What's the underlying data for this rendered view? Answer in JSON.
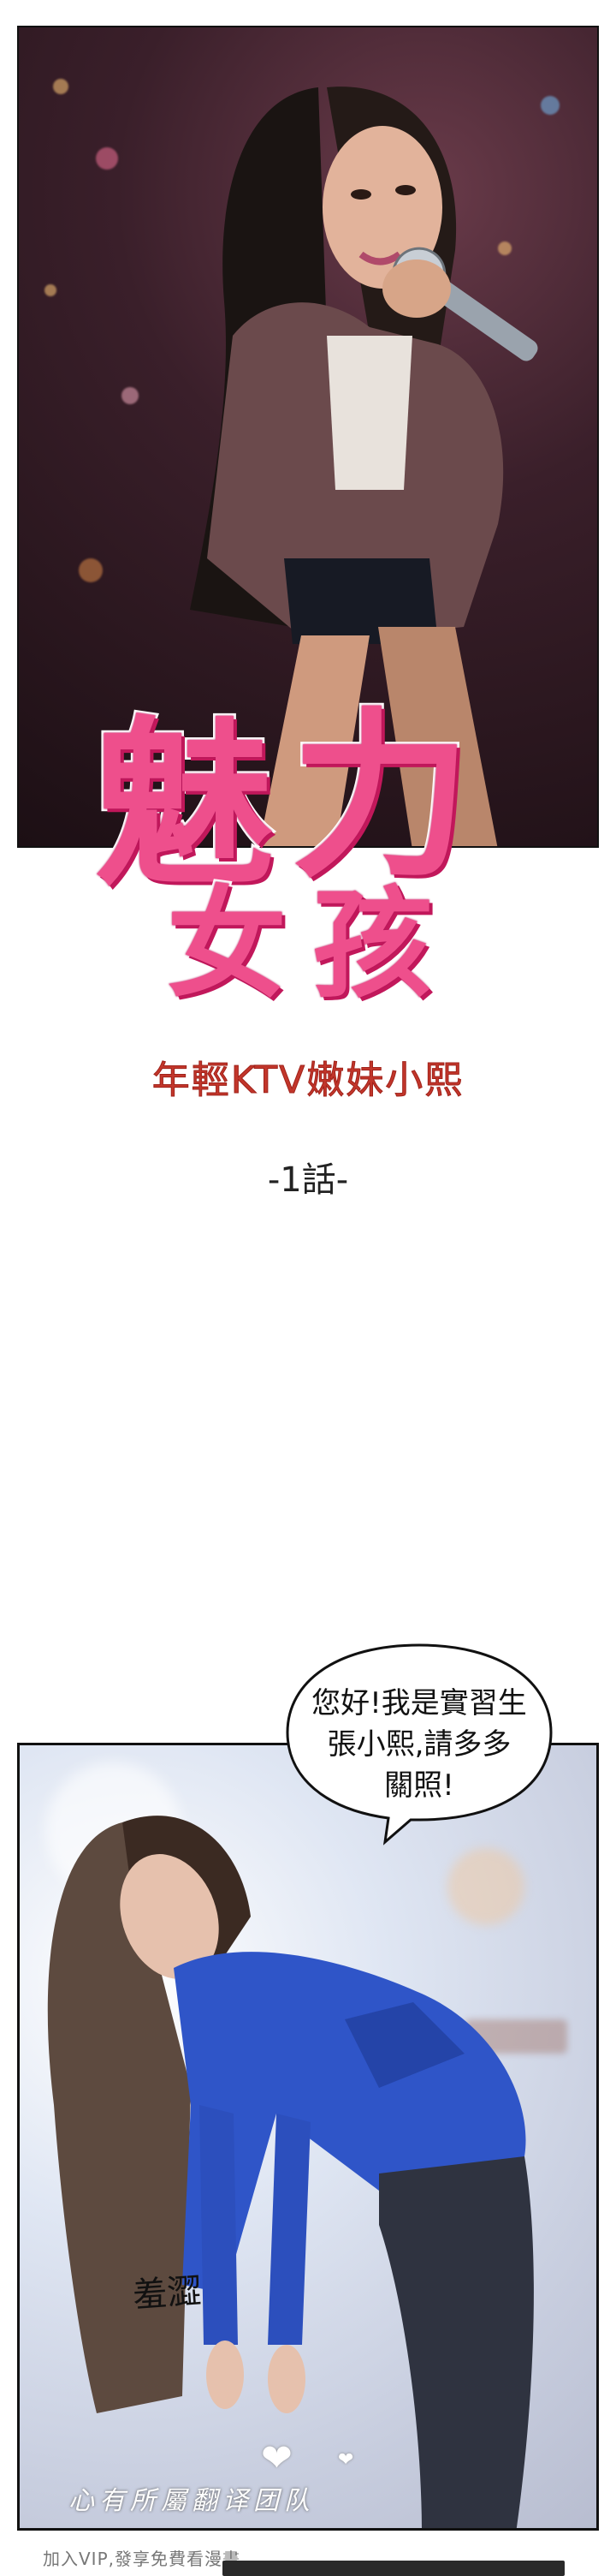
{
  "title": {
    "line1": [
      "魅",
      "力"
    ],
    "line2": [
      "女",
      "孩"
    ]
  },
  "subtitle": "年輕KTV嫩妹小熙",
  "chapter": "-1話-",
  "speech_bubble": {
    "text": "您好!我是實習生\n張小熙,請多多\n關照!"
  },
  "sfx": "羞澀",
  "watermark": "心有所屬翻译团队",
  "footer_note": "加入VIP,發享免費看漫畫",
  "colors": {
    "logo_pink": "#ee4f8c",
    "subtitle_red": "#c2362b",
    "shirt_blue": "#2f55c8"
  }
}
